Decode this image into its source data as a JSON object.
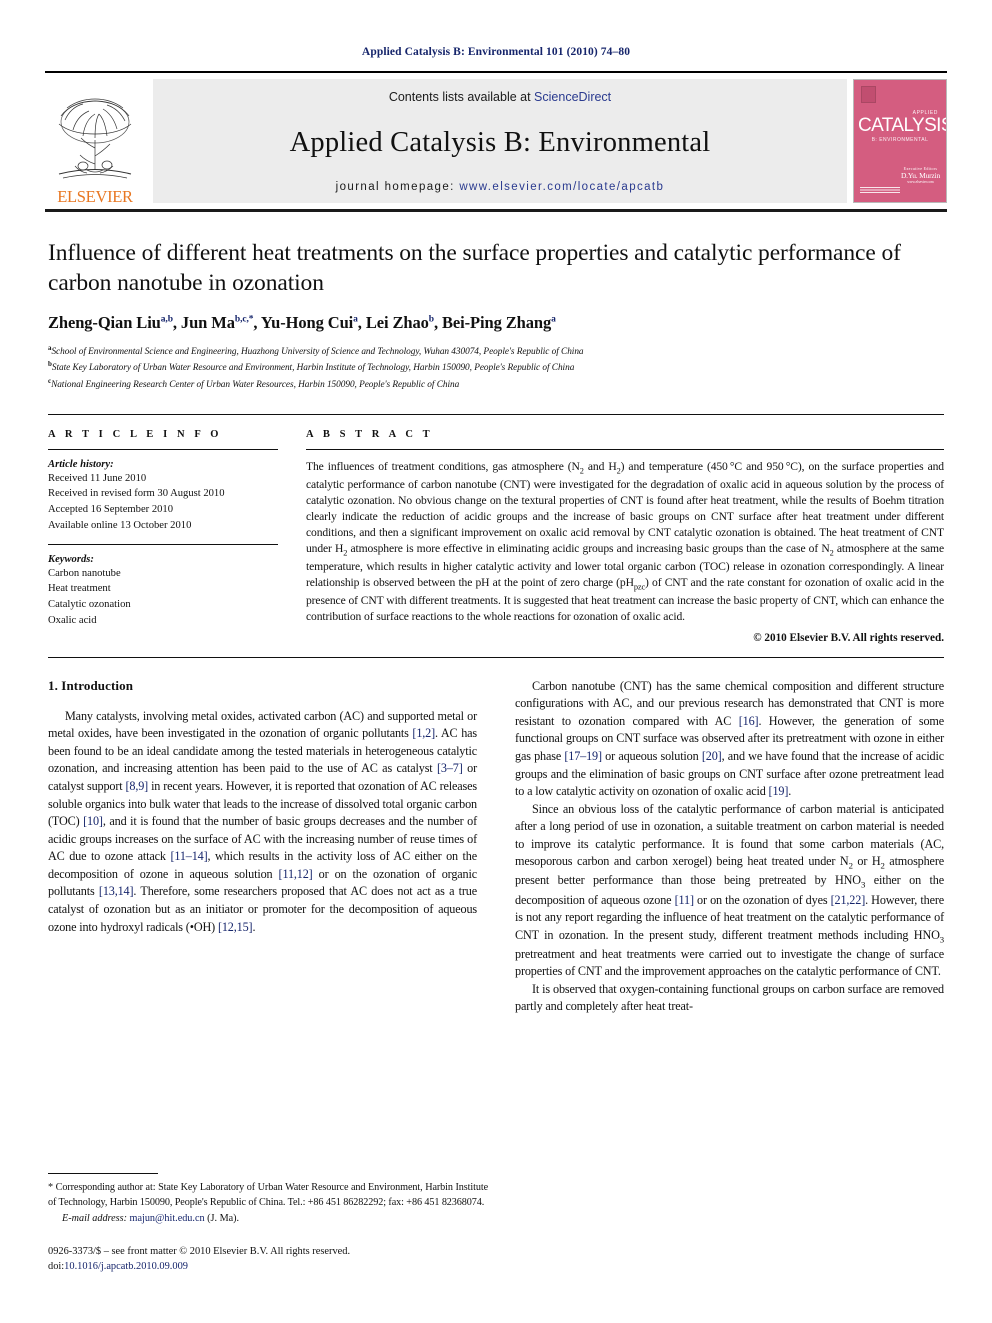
{
  "running_head": "Applied Catalysis B: Environmental 101 (2010) 74–80",
  "masthead": {
    "publisher": "ELSEVIER",
    "contents_prefix": "Contents lists available at ",
    "contents_link": "ScienceDirect",
    "journal_title": "Applied Catalysis B: Environmental",
    "homepage_prefix": "journal homepage: ",
    "homepage_url": "www.elsevier.com/locate/apcatb",
    "cover": {
      "applied": "APPLIED",
      "catalysis": "CATALYSIS",
      "subtitle": "B: ENVIRONMENTAL",
      "editor_label": "Executive Editors",
      "editor_name": "D.Yu. Murzin",
      "editor_sub": "www.elsevier.com"
    },
    "colors": {
      "link": "#2a3a8f",
      "elsevier_orange": "#e87722",
      "banner_bg": "#ececec",
      "cover_pink": "#d45d80"
    }
  },
  "article": {
    "title": "Influence of different heat treatments on the surface properties and catalytic performance of carbon nanotube in ozonation",
    "authors_html": "Zheng-Qian Liu<sup>a,b</sup>, Jun Ma<sup>b,c,*</sup>, Yu-Hong Cui<sup>a</sup>, Lei Zhao<sup>b</sup>, Bei-Ping Zhang<sup>a</sup>",
    "affiliations": [
      {
        "marker": "a",
        "text": "School of Environmental Science and Engineering, Huazhong University of Science and Technology, Wuhan 430074, People's Republic of China"
      },
      {
        "marker": "b",
        "text": "State Key Laboratory of Urban Water Resource and Environment, Harbin Institute of Technology, Harbin 150090, People's Republic of China"
      },
      {
        "marker": "c",
        "text": "National Engineering Research Center of Urban Water Resources, Harbin 150090, People's Republic of China"
      }
    ]
  },
  "article_info": {
    "heading": "A R T I C L E    I N F O",
    "history_heading": "Article history:",
    "history": [
      "Received 11 June 2010",
      "Received in revised form 30 August 2010",
      "Accepted 16 September 2010",
      "Available online 13 October 2010"
    ],
    "keywords_heading": "Keywords:",
    "keywords": [
      "Carbon nanotube",
      "Heat treatment",
      "Catalytic ozonation",
      "Oxalic acid"
    ]
  },
  "abstract": {
    "heading": "A B S T R A C T",
    "body_html": "The influences of treatment conditions, gas atmosphere (N<sub>2</sub> and H<sub>2</sub>) and temperature (450&#8201;&#176;C and 950&#8201;&#176;C), on the surface properties and catalytic performance of carbon nanotube (CNT) were investigated for the degradation of oxalic acid in aqueous solution by the process of catalytic ozonation. No obvious change on the textural properties of CNT is found after heat treatment, while the results of Boehm titration clearly indicate the reduction of acidic groups and the increase of basic groups on CNT surface after heat treatment under different conditions, and then a significant improvement on oxalic acid removal by CNT catalytic ozonation is obtained. The heat treatment of CNT under H<sub>2</sub> atmosphere is more effective in eliminating acidic groups and increasing basic groups than the case of N<sub>2</sub> atmosphere at the same temperature, which results in higher catalytic activity and lower total organic carbon (TOC) release in ozonation correspondingly. A linear relationship is observed between the pH at the point of zero charge (pH<sub>pzc</sub>) of CNT and the rate constant for ozonation of oxalic acid in the presence of CNT with different treatments. It is suggested that heat treatment can increase the basic property of CNT, which can enhance the contribution of surface reactions to the whole reactions for ozonation of oxalic acid.",
    "copyright": "© 2010 Elsevier B.V. All rights reserved."
  },
  "body": {
    "section_title": "1.  Introduction",
    "left_paragraphs_html": [
      "Many catalysts, involving metal oxides, activated carbon (AC) and supported metal or metal oxides, have been investigated in the ozonation of organic pollutants <span class=\"ref\">[1,2]</span>. AC has been found to be an ideal candidate among the tested materials in heterogeneous catalytic ozonation, and increasing attention has been paid to the use of AC as catalyst <span class=\"ref\">[3–7]</span> or catalyst support <span class=\"ref\">[8,9]</span> in recent years. However, it is reported that ozonation of AC releases soluble organics into bulk water that leads to the increase of dissolved total organic carbon (TOC) <span class=\"ref\">[10]</span>, and it is found that the number of basic groups decreases and the number of acidic groups increases on the surface of AC with the increasing number of reuse times of AC due to ozone attack <span class=\"ref\">[11–14]</span>, which results in the activity loss of AC either on the decomposition of ozone in aqueous solution <span class=\"ref\">[11,12]</span> or on the ozonation of organic pollutants <span class=\"ref\">[13,14]</span>. Therefore, some researchers proposed that AC does not act as a true catalyst of ozonation but as an initiator or promoter for the decomposition of aqueous ozone into hydroxyl radicals (•OH) <span class=\"ref\">[12,15]</span>."
    ],
    "right_paragraphs_html": [
      "Carbon nanotube (CNT) has the same chemical composition and different structure configurations with AC, and our previous research has demonstrated that CNT is more resistant to ozonation compared with AC <span class=\"ref\">[16]</span>. However, the generation of some functional groups on CNT surface was observed after its pretreatment with ozone in either gas phase <span class=\"ref\">[17–19]</span> or aqueous solution <span class=\"ref\">[20]</span>, and we have found that the increase of acidic groups and the elimination of basic groups on CNT surface after ozone pretreatment lead to a low catalytic activity on ozonation of oxalic acid <span class=\"ref\">[19]</span>.",
      "Since an obvious loss of the catalytic performance of carbon material is anticipated after a long period of use in ozonation, a suitable treatment on carbon material is needed to improve its catalytic performance. It is found that some carbon materials (AC, mesoporous carbon and carbon xerogel) being heat treated under N<sub>2</sub> or H<sub>2</sub> atmosphere present better performance than those being pretreated by HNO<sub>3</sub> either on the decomposition of aqueous ozone <span class=\"ref\">[11]</span> or on the ozonation of dyes <span class=\"ref\">[21,22]</span>. However, there is not any report regarding the influence of heat treatment on the catalytic performance of CNT in ozonation. In the present study, different treatment methods including HNO<sub>3</sub> pretreatment and heat treatments were carried out to investigate the change of surface properties of CNT and the improvement approaches on the catalytic performance of CNT.",
      "It is observed that oxygen-containing functional groups on carbon surface are removed partly and completely after heat treat-"
    ]
  },
  "footnotes": {
    "corresponding_html": "* Corresponding author at: State Key Laboratory of Urban Water Resource and Environment, Harbin Institute of Technology, Harbin 150090, People's Republic of China. Tel.: +86 451 86282292; fax: +86 451 82368074.",
    "email_label": "E-mail address:",
    "email": "majun@hit.edu.cn",
    "email_suffix": "(J. Ma).",
    "issn_line": "0926-3373/$ – see front matter © 2010 Elsevier B.V. All rights reserved.",
    "doi_prefix": "doi:",
    "doi": "10.1016/j.apcatb.2010.09.009"
  }
}
